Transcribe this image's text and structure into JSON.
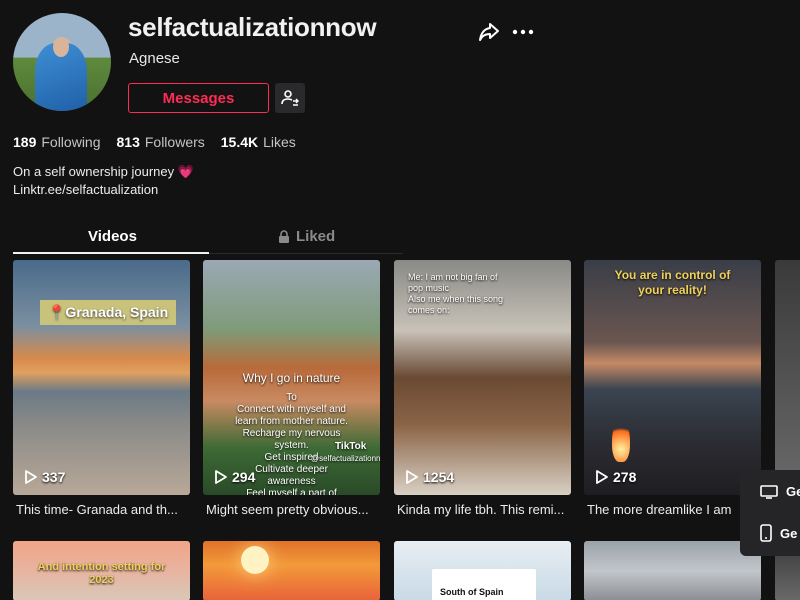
{
  "profile": {
    "username": "selfactualizationnow",
    "nickname": "Agnese",
    "message_label": "Messages"
  },
  "stats": {
    "following_count": "189",
    "following_label": "Following",
    "followers_count": "813",
    "followers_label": "Followers",
    "likes_count": "15.4K",
    "likes_label": "Likes"
  },
  "bio": {
    "line1": "On a self ownership journey 💗",
    "link": "Linktr.ee/selfactualization"
  },
  "tabs": {
    "videos": "Videos",
    "liked": "Liked"
  },
  "videos": [
    {
      "views": "337",
      "caption": "This time- Granada and th...",
      "overlay": "📍Granada, Spain"
    },
    {
      "views": "294",
      "caption": "Might seem pretty obvious...",
      "overlay_title": "Why I go in nature",
      "overlay_body": "To\nConnect with myself and\nlearn from mother nature.\nRecharge my nervous\nsystem.\nGet inspired\nCultivate deeper\nawareness\nFeel myself a part of",
      "watermark": "TikTok",
      "handle": "@selfactualizationnow"
    },
    {
      "views": "1254",
      "caption": "Kinda my life tbh. This remi...",
      "overlay": "Me: I am not big fan of\npop music\nAlso me when this song\ncomes on:"
    },
    {
      "views": "278",
      "caption": "The more dreamlike I am",
      "overlay": "You are in control of\nyour reality!"
    }
  ],
  "second_row": [
    {
      "overlay": "And intention setting for\n2023"
    },
    {
      "overlay": ""
    },
    {
      "overlay": "South of Spain"
    },
    {
      "overlay": ""
    }
  ],
  "popup": {
    "row1": "Ge",
    "row2": "Ge"
  },
  "colors": {
    "accent": "#fe2c55",
    "background": "#121212"
  }
}
